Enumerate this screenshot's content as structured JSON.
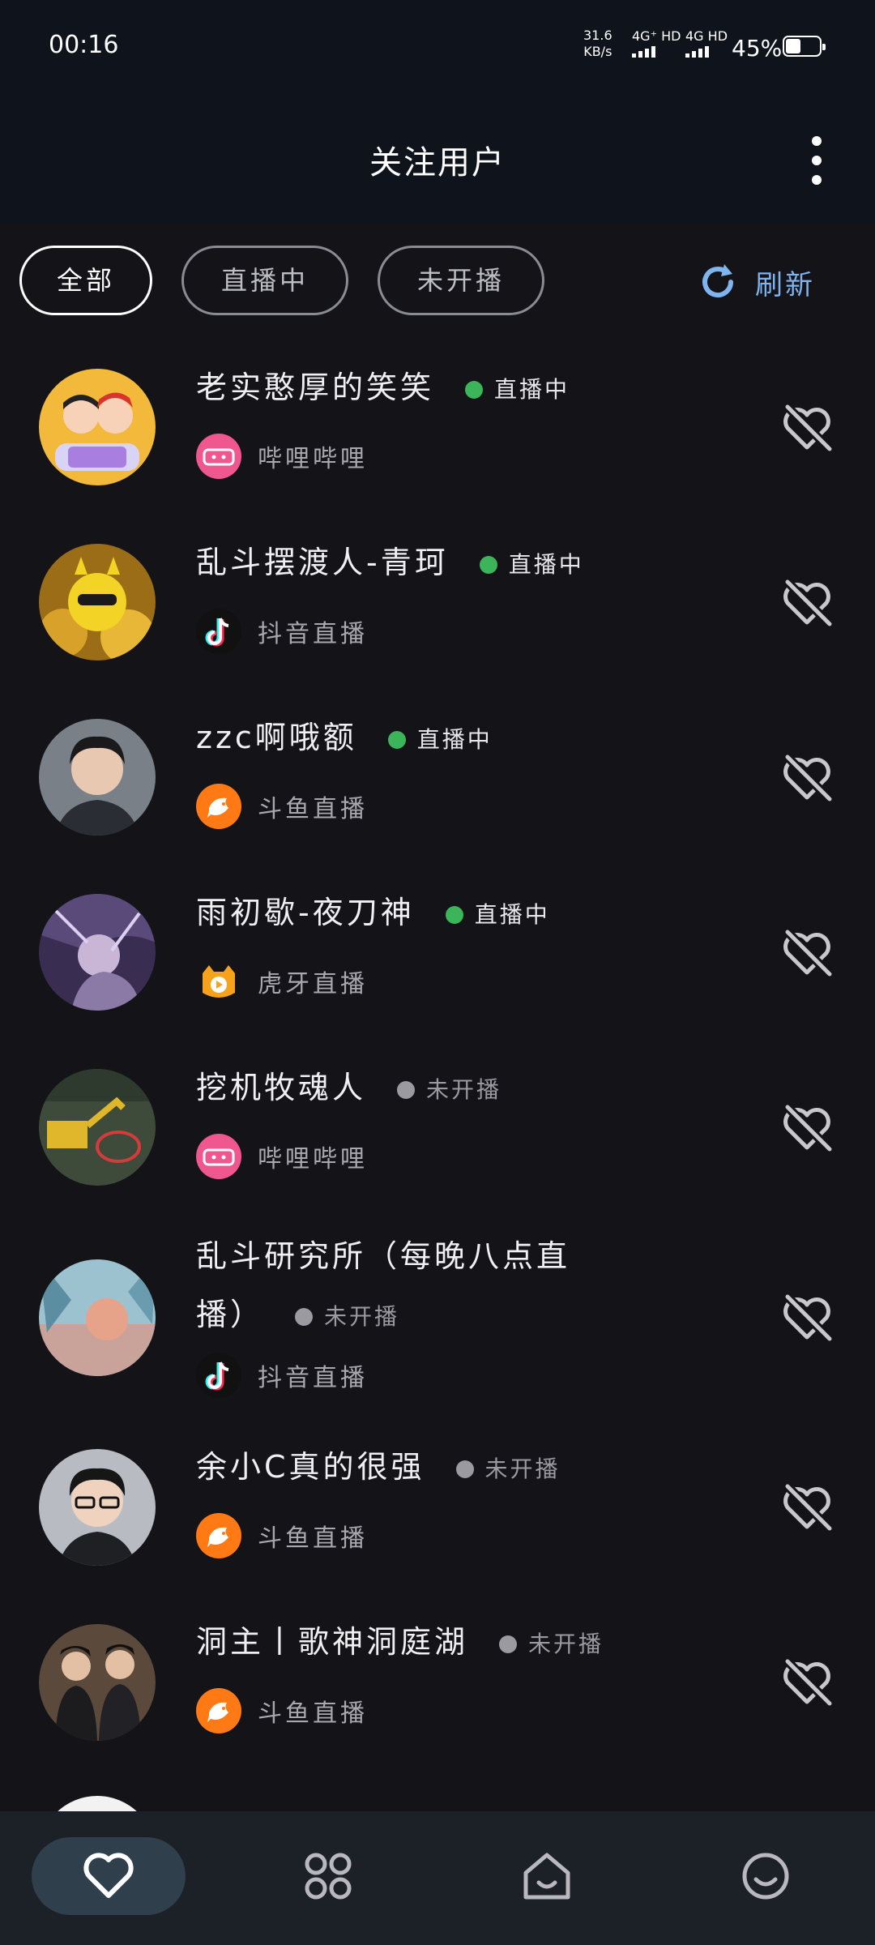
{
  "status_bar": {
    "time": "00:16",
    "net_speed_value": "31.6",
    "net_speed_unit": "KB/s",
    "sim1": "4G⁺ HD",
    "sim2": "4G HD",
    "battery_percent": "45%",
    "battery_level": 0.45
  },
  "header": {
    "title": "关注用户"
  },
  "filters": {
    "tabs": [
      {
        "label": "全部",
        "active": true
      },
      {
        "label": "直播中",
        "active": false
      },
      {
        "label": "未开播",
        "active": false
      }
    ],
    "refresh_label": "刷新"
  },
  "streamers": [
    {
      "name": "老实憨厚的笑笑",
      "status": "直播中",
      "live": true,
      "platform": "哔哩哔哩",
      "platform_icon": "bilibili-icon"
    },
    {
      "name": "乱斗摆渡人-青珂",
      "status": "直播中",
      "live": true,
      "platform": "抖音直播",
      "platform_icon": "douyin-icon"
    },
    {
      "name": "zzc啊哦额",
      "status": "直播中",
      "live": true,
      "platform": "斗鱼直播",
      "platform_icon": "douyu-icon"
    },
    {
      "name": "雨初歇-夜刀神",
      "status": "直播中",
      "live": true,
      "platform": "虎牙直播",
      "platform_icon": "huya-icon"
    },
    {
      "name": "挖机牧魂人",
      "status": "未开播",
      "live": false,
      "platform": "哔哩哔哩",
      "platform_icon": "bilibili-icon"
    },
    {
      "name_line1": "乱斗研究所（每晚八点直",
      "name_line2": "播）",
      "status": "未开播",
      "live": false,
      "platform": "抖音直播",
      "platform_icon": "douyin-icon"
    },
    {
      "name": "余小C真的很强",
      "status": "未开播",
      "live": false,
      "platform": "斗鱼直播",
      "platform_icon": "douyu-icon"
    },
    {
      "name": "洞主丨歌神洞庭湖",
      "status": "未开播",
      "live": false,
      "platform": "斗鱼直播",
      "platform_icon": "douyu-icon"
    }
  ],
  "bottom_nav": [
    {
      "icon": "heart-icon",
      "active": true
    },
    {
      "icon": "apps-grid-icon",
      "active": false
    },
    {
      "icon": "home-icon",
      "active": false
    },
    {
      "icon": "smiley-icon",
      "active": false
    }
  ],
  "colors": {
    "background": "#131318",
    "live_dot": "#3cb55a",
    "offline_dot": "#9a9aa0",
    "accent_blue": "#7fb4ee",
    "active_nav_bg": "#2f3f4c"
  }
}
